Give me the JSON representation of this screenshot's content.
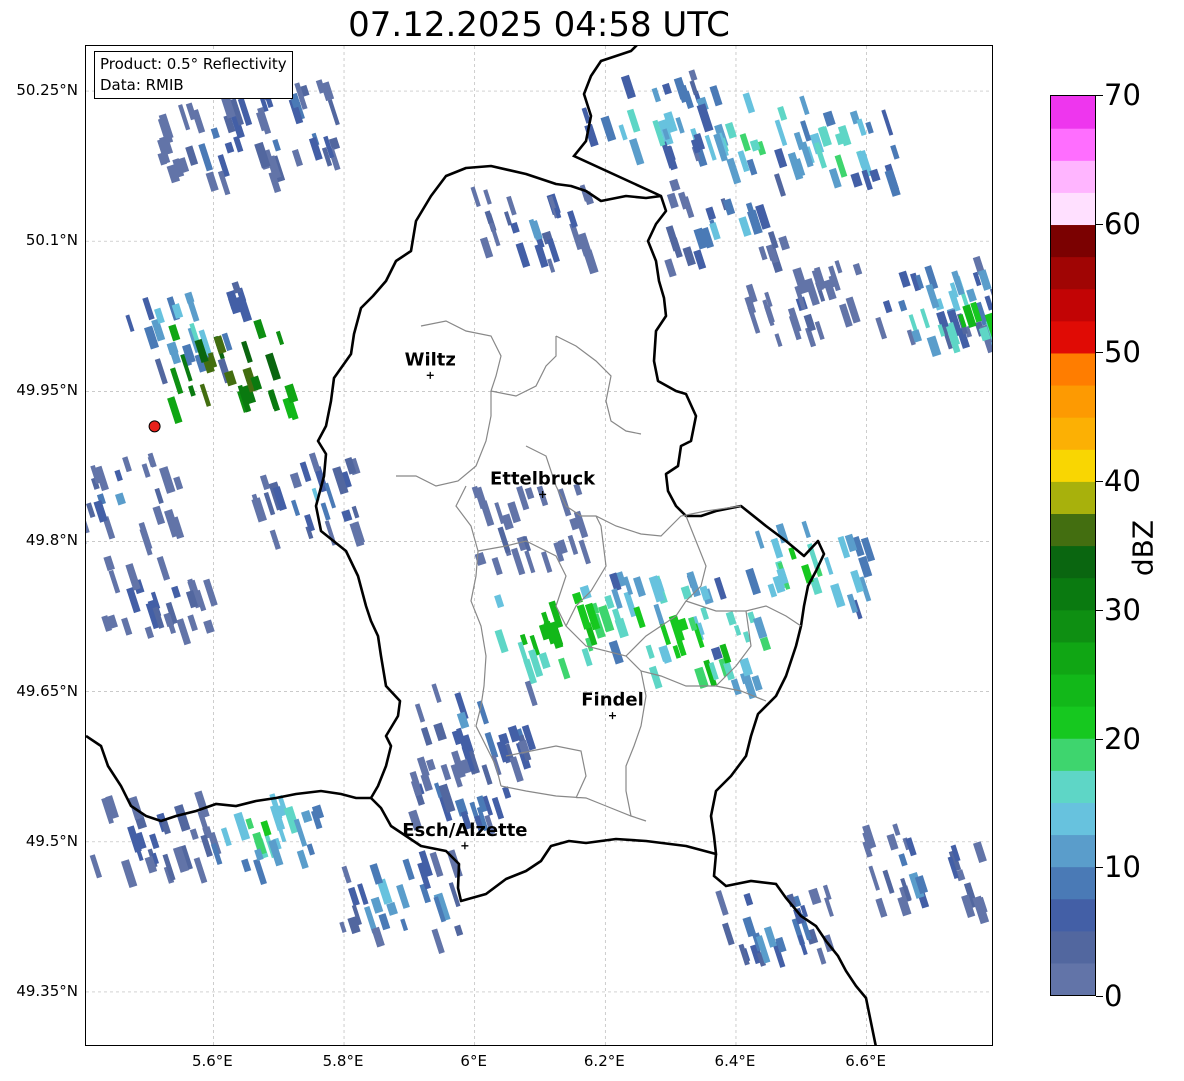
{
  "title": "07.12.2025 04:58 UTC",
  "info": {
    "product": "Product: 0.5° Reflectivity",
    "data": "Data: RMIB"
  },
  "map": {
    "lon_range": [
      5.405,
      6.795
    ],
    "lat_range": [
      49.295,
      50.295
    ],
    "lat_ticks": [
      "50.25°N",
      "50.1°N",
      "49.95°N",
      "49.8°N",
      "49.65°N",
      "49.5°N",
      "49.35°N"
    ],
    "lat_values": [
      50.25,
      50.1,
      49.95,
      49.8,
      49.65,
      49.5,
      49.35
    ],
    "lon_ticks": [
      "5.6°E",
      "5.8°E",
      "6°E",
      "6.2°E",
      "6.4°E",
      "6.6°E"
    ],
    "lon_values": [
      5.6,
      5.8,
      6.0,
      6.2,
      6.4,
      6.6
    ],
    "grid": true,
    "radar_site": {
      "lon": 5.51,
      "lat": 49.915,
      "color": "#e8211b"
    },
    "cities": [
      {
        "name": "Wiltz",
        "lon": 5.932,
        "lat": 49.966
      },
      {
        "name": "Ettelbruck",
        "lon": 6.104,
        "lat": 49.847
      },
      {
        "name": "Findel",
        "lon": 6.211,
        "lat": 49.626
      },
      {
        "name": "Esch/Alzette",
        "lon": 5.985,
        "lat": 49.496
      }
    ],
    "echo_cells": [
      {
        "lon": 6.55,
        "lat": 50.2,
        "dbz": 20
      },
      {
        "lon": 6.42,
        "lat": 50.22,
        "dbz": 22
      },
      {
        "lon": 6.25,
        "lat": 50.23,
        "dbz": 18
      },
      {
        "lon": 6.38,
        "lat": 50.12,
        "dbz": 14
      },
      {
        "lon": 6.7,
        "lat": 50.05,
        "dbz": 16
      },
      {
        "lon": 6.75,
        "lat": 50.03,
        "dbz": 24
      },
      {
        "lon": 6.08,
        "lat": 50.12,
        "dbz": 12
      },
      {
        "lon": 5.7,
        "lat": 50.22,
        "dbz": 14
      },
      {
        "lon": 5.6,
        "lat": 50.2,
        "dbz": 10
      },
      {
        "lon": 5.55,
        "lat": 50.02,
        "dbz": 18
      },
      {
        "lon": 5.62,
        "lat": 49.98,
        "dbz": 42
      },
      {
        "lon": 5.45,
        "lat": 49.85,
        "dbz": 10
      },
      {
        "lon": 5.5,
        "lat": 49.75,
        "dbz": 8
      },
      {
        "lon": 5.75,
        "lat": 49.85,
        "dbz": 12
      },
      {
        "lon": 6.12,
        "lat": 49.72,
        "dbz": 28
      },
      {
        "lon": 6.28,
        "lat": 49.73,
        "dbz": 24
      },
      {
        "lon": 6.35,
        "lat": 49.7,
        "dbz": 26
      },
      {
        "lon": 6.5,
        "lat": 49.78,
        "dbz": 22
      },
      {
        "lon": 6.0,
        "lat": 49.62,
        "dbz": 14
      },
      {
        "lon": 5.98,
        "lat": 49.55,
        "dbz": 12
      },
      {
        "lon": 5.88,
        "lat": 49.45,
        "dbz": 16
      },
      {
        "lon": 6.45,
        "lat": 49.42,
        "dbz": 14
      },
      {
        "lon": 6.68,
        "lat": 49.48,
        "dbz": 12
      },
      {
        "lon": 6.08,
        "lat": 49.82,
        "dbz": 8
      },
      {
        "lon": 6.5,
        "lat": 50.04,
        "dbz": 6
      },
      {
        "lon": 5.5,
        "lat": 49.51,
        "dbz": 10
      },
      {
        "lon": 5.67,
        "lat": 49.52,
        "dbz": 20
      }
    ]
  },
  "colorbar": {
    "label": "dBZ",
    "ticks": [
      "0",
      "10",
      "20",
      "30",
      "40",
      "50",
      "60",
      "70"
    ],
    "tick_values": [
      0,
      10,
      20,
      30,
      40,
      50,
      60,
      70
    ],
    "range": [
      0,
      70
    ],
    "colors": [
      "#6274a8",
      "#52679f",
      "#435fa6",
      "#4a7ab6",
      "#5a9dcb",
      "#67c2de",
      "#5ed6c6",
      "#3ed56e",
      "#16c81f",
      "#12b819",
      "#10a614",
      "#0e8f12",
      "#0a7a10",
      "#0a6610",
      "#436e10",
      "#a8b10c",
      "#f9d602",
      "#fcb004",
      "#fd9a02",
      "#ff7d00",
      "#e00b05",
      "#c20405",
      "#a00504",
      "#7b0101",
      "#ffe0ff",
      "#ffb5ff",
      "#ff6eff",
      "#ee36ee"
    ]
  }
}
